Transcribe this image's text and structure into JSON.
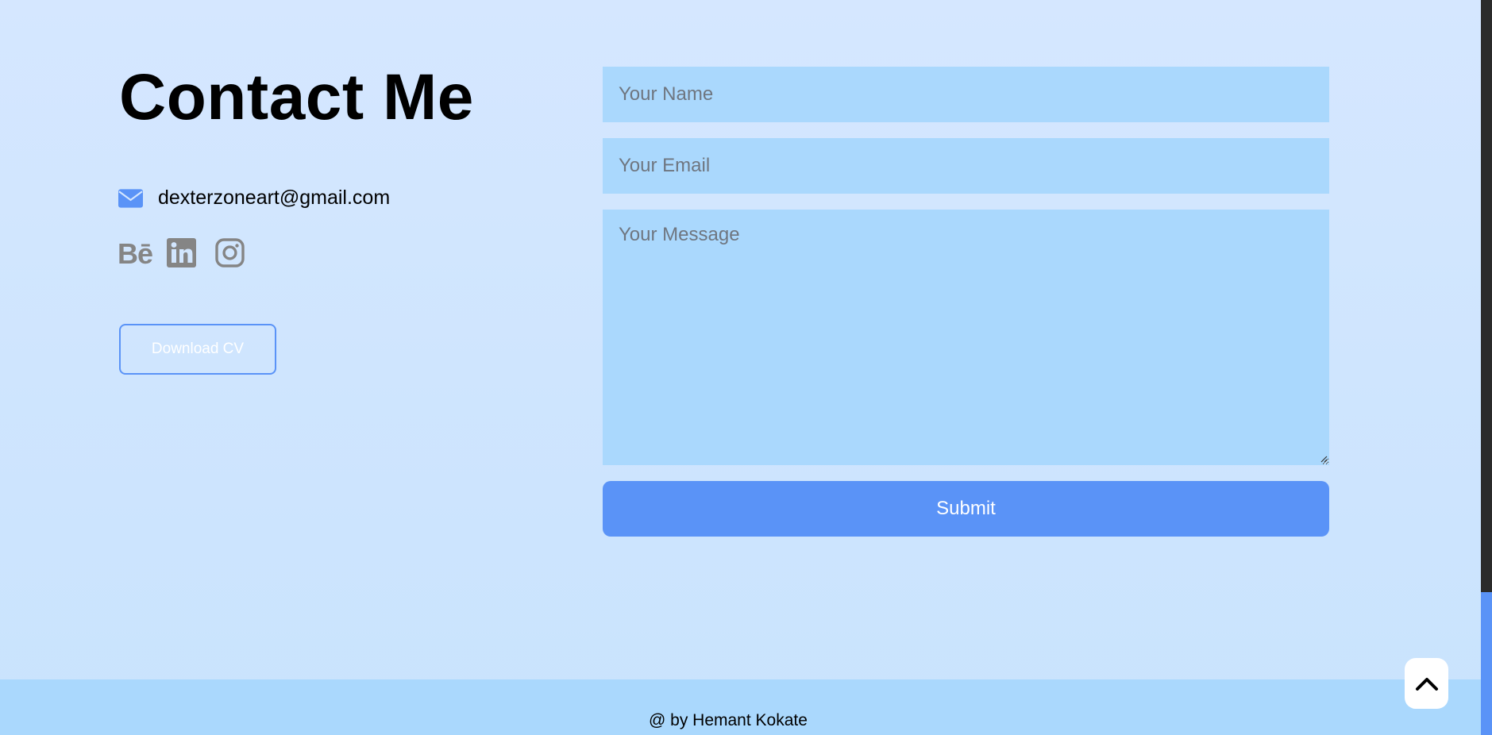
{
  "contact": {
    "title": "Contact Me",
    "email": "dexterzoneart@gmail.com",
    "social": [
      "behance-icon",
      "linkedin-icon",
      "instagram-icon"
    ],
    "download_label": "Download CV"
  },
  "form": {
    "name_placeholder": "Your Name",
    "email_placeholder": "Your Email",
    "message_placeholder": "Your Message",
    "submit_label": "Submit"
  },
  "footer": {
    "text": "@ by Hemant Kokate"
  },
  "colors": {
    "accent": "#5a93f7",
    "field_bg": "#aad8fd",
    "page_bg": "#d5e7ff",
    "icon_gray": "#858585"
  }
}
